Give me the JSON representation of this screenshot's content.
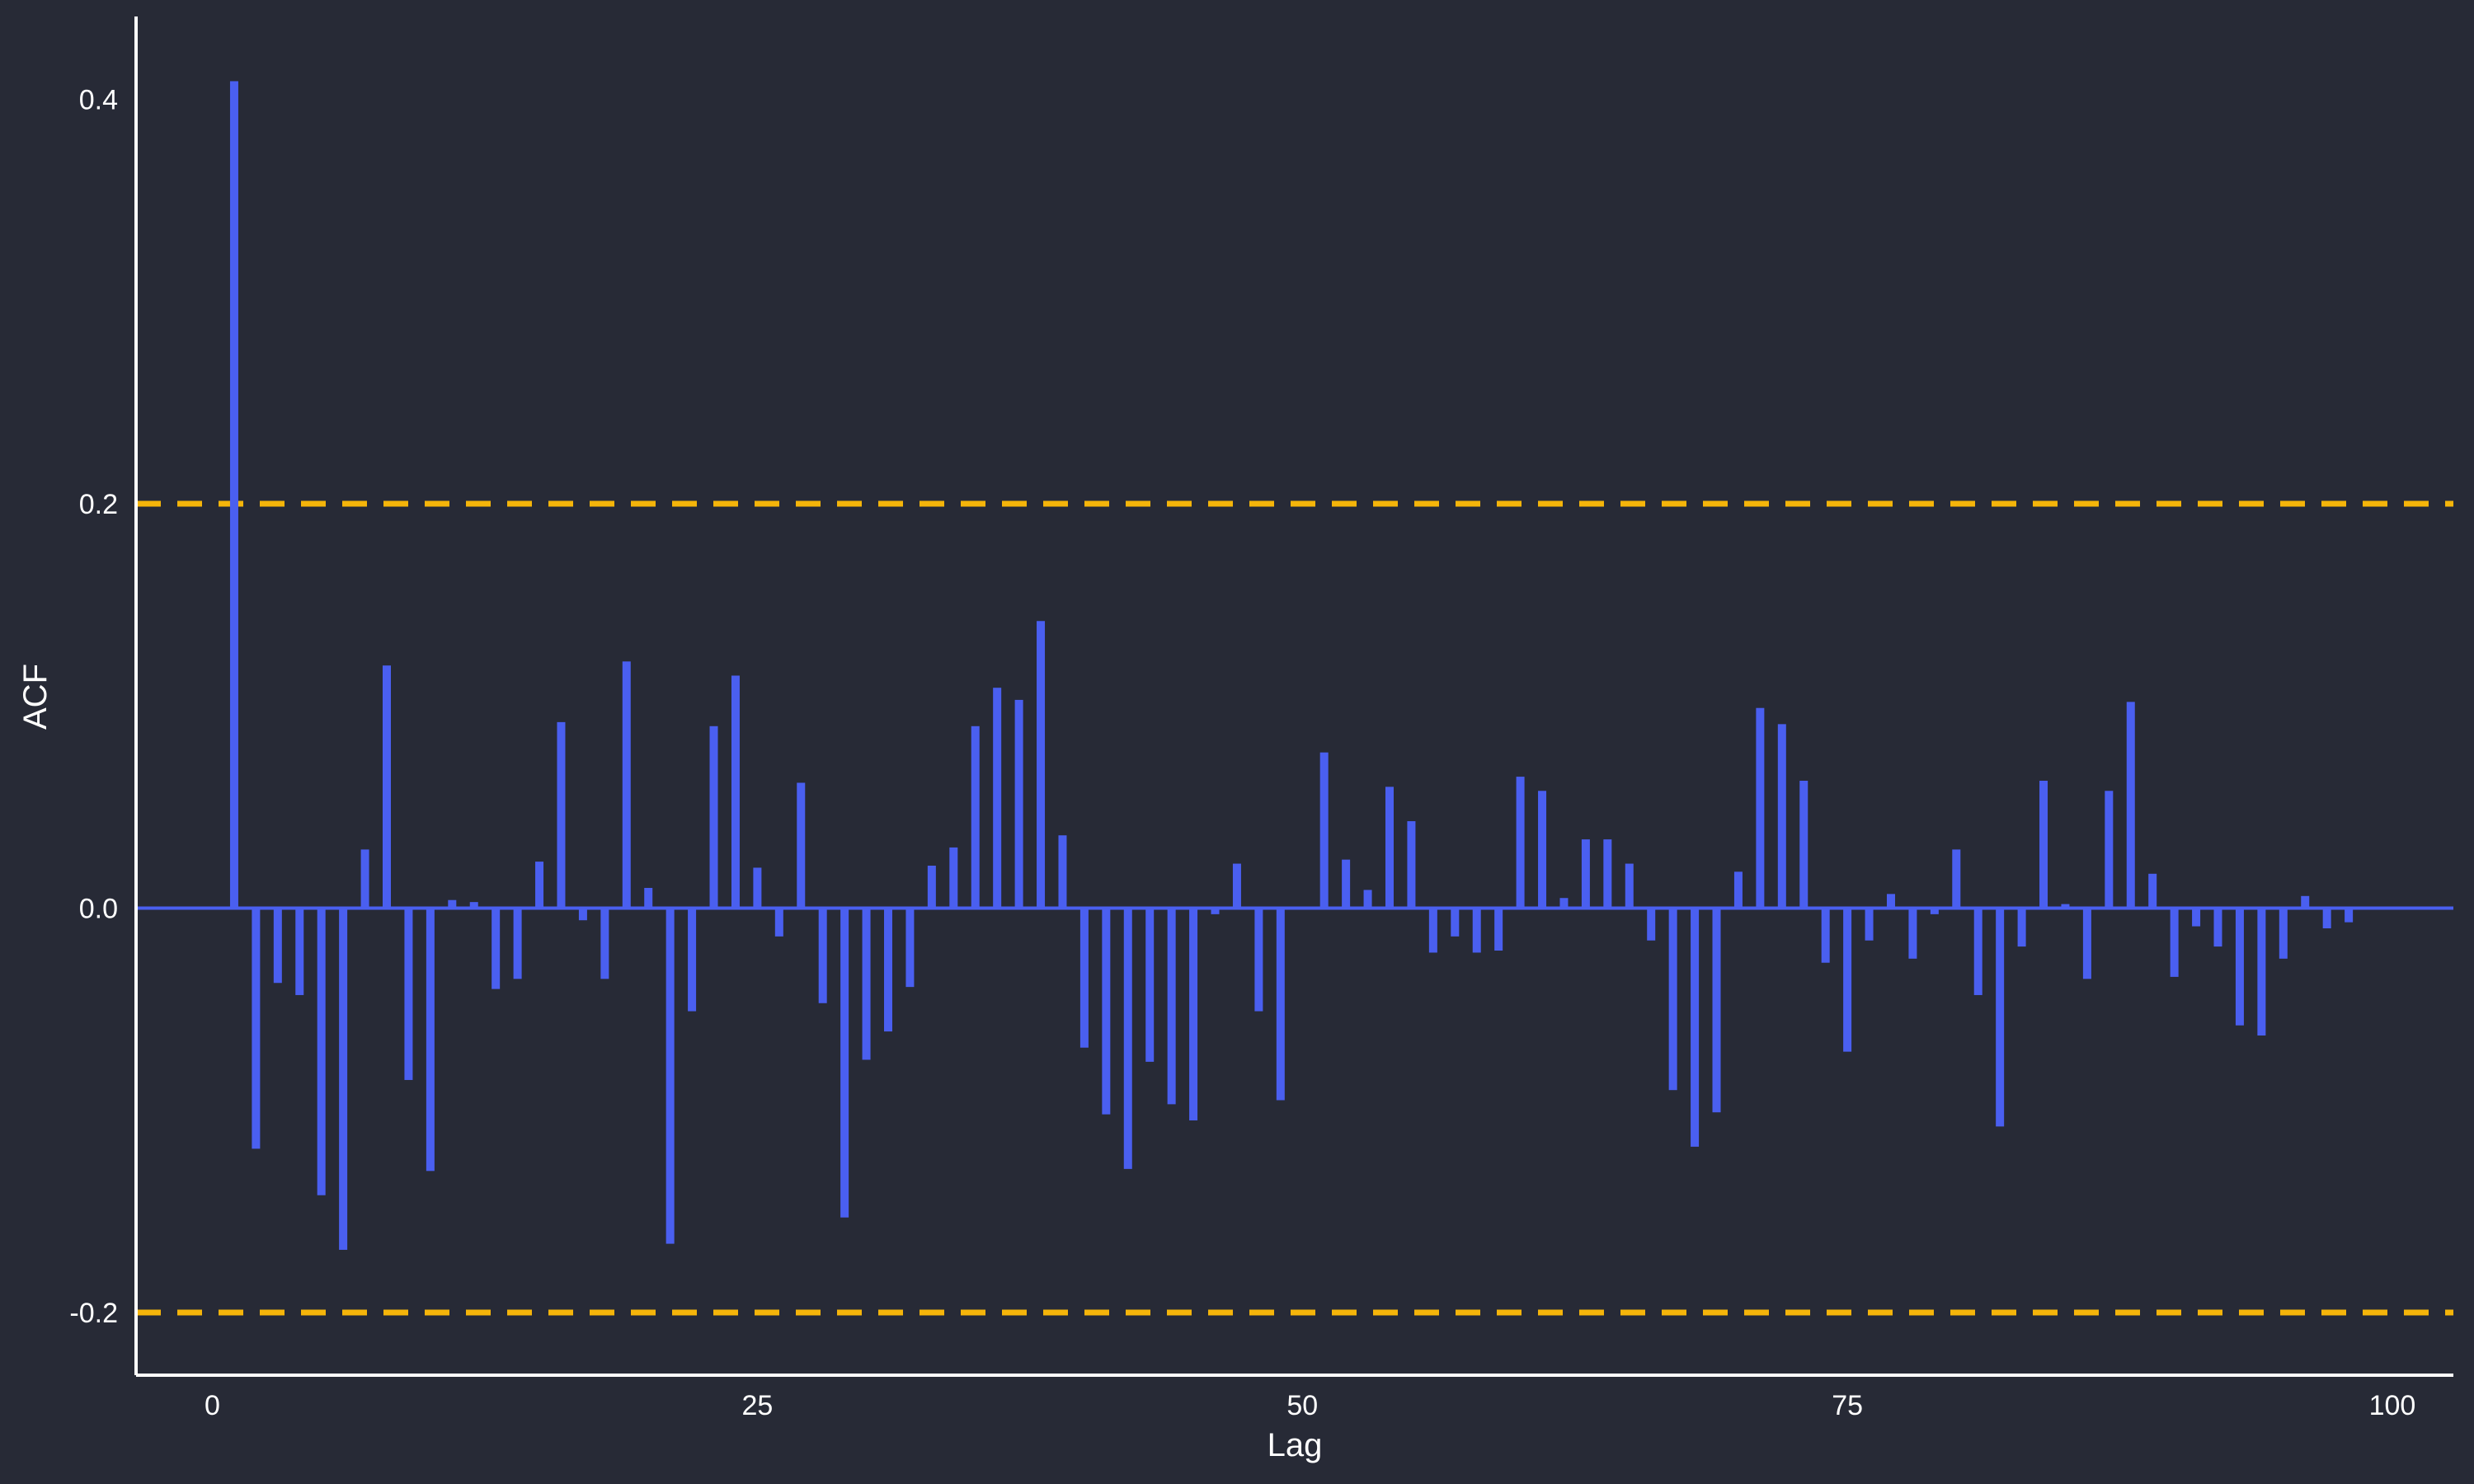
{
  "chart_data": {
    "type": "bar",
    "title": "",
    "xlabel": "Lag",
    "ylabel": "ACF",
    "xlim": [
      -3.5,
      102.8
    ],
    "ylim": [
      -0.231,
      0.441
    ],
    "x_ticks": [
      0,
      25,
      50,
      75,
      100
    ],
    "y_ticks": [
      -0.2,
      0.0,
      0.2,
      0.4
    ],
    "x_tick_labels": [
      "0",
      "25",
      "50",
      "75",
      "100"
    ],
    "y_tick_labels": [
      "-0.2",
      "0.0",
      "0.2",
      "0.4"
    ],
    "confidence_bounds": [
      0.2,
      -0.2
    ],
    "grid": false,
    "colors": {
      "background": "#272a36",
      "bars": "#4a5ff0",
      "bounds": "#f5b50a",
      "axis": "#ffffff",
      "text": "#ffffff"
    },
    "lags": [
      1,
      2,
      3,
      4,
      5,
      6,
      7,
      8,
      9,
      10,
      11,
      12,
      13,
      14,
      15,
      16,
      17,
      18,
      19,
      20,
      21,
      22,
      23,
      24,
      25,
      26,
      27,
      28,
      29,
      30,
      31,
      32,
      33,
      34,
      35,
      36,
      37,
      38,
      39,
      40,
      41,
      42,
      43,
      44,
      45,
      46,
      47,
      48,
      49,
      50,
      51,
      52,
      53,
      54,
      55,
      56,
      57,
      58,
      59,
      60,
      61,
      62,
      63,
      64,
      65,
      66,
      67,
      68,
      69,
      70,
      71,
      72,
      73,
      74,
      75,
      76,
      77,
      78,
      79,
      80,
      81,
      82,
      83,
      84,
      85,
      86,
      87,
      88,
      89,
      90,
      91,
      92,
      93,
      94,
      95,
      96,
      97,
      98
    ],
    "values": [
      0.409,
      -0.119,
      -0.037,
      -0.043,
      -0.142,
      -0.169,
      0.029,
      0.12,
      -0.085,
      -0.13,
      0.004,
      0.003,
      -0.04,
      -0.035,
      0.023,
      0.092,
      -0.006,
      -0.035,
      0.122,
      0.01,
      -0.166,
      -0.051,
      0.09,
      0.115,
      0.02,
      -0.014,
      0.062,
      -0.047,
      -0.153,
      -0.075,
      -0.061,
      -0.039,
      0.021,
      0.03,
      0.09,
      0.109,
      0.103,
      0.142,
      0.036,
      -0.069,
      -0.102,
      -0.129,
      -0.076,
      -0.097,
      -0.105,
      -0.003,
      0.022,
      -0.051,
      -0.095,
      0.0,
      0.077,
      0.024,
      0.009,
      0.06,
      0.043,
      -0.022,
      -0.014,
      -0.022,
      -0.021,
      0.065,
      0.058,
      0.005,
      0.034,
      0.034,
      0.022,
      -0.016,
      -0.09,
      -0.118,
      -0.101,
      0.018,
      0.099,
      0.091,
      0.063,
      -0.027,
      -0.071,
      -0.016,
      0.007,
      -0.025,
      -0.003,
      0.029,
      -0.043,
      -0.108,
      -0.019,
      0.063,
      0.002,
      -0.035,
      0.058,
      0.102,
      0.017,
      -0.034,
      -0.009,
      -0.019,
      -0.058,
      -0.063,
      -0.025,
      0.006,
      -0.01,
      -0.007
    ]
  }
}
